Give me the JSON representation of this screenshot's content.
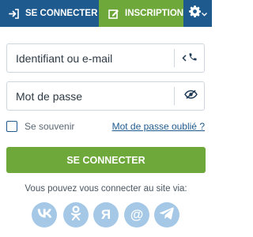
{
  "tabs": {
    "login": {
      "label": "SE CONNECTER",
      "icon": "sign-in-icon"
    },
    "signup": {
      "label": "INSCRIPTION",
      "icon": "edit-icon"
    },
    "settings": {
      "icon": "gear-icon"
    }
  },
  "form": {
    "login_field": {
      "placeholder": "Identifiant ou e-mail",
      "value": ""
    },
    "password_field": {
      "placeholder": "Mot de passe",
      "value": ""
    },
    "remember_label": "Se souvenir",
    "remember_checked": false,
    "forgot_link": "Mot de passe oublié ?",
    "submit_label": "SE CONNECTER"
  },
  "social": {
    "caption": "Vous pouvez vous connecter au site via:",
    "providers": [
      {
        "name": "VK",
        "icon": "vk-icon"
      },
      {
        "name": "Odnoklassniki",
        "icon": "odnoklassniki-icon"
      },
      {
        "name": "Yandex",
        "icon": "yandex-icon",
        "glyph": "Я"
      },
      {
        "name": "Mail.ru",
        "icon": "mail-at-icon",
        "glyph": "@"
      },
      {
        "name": "Telegram",
        "icon": "telegram-icon"
      }
    ]
  },
  "colors": {
    "primary": "#1f5a8f",
    "accent": "#6fa83a",
    "social": "#a5c8e6",
    "border": "#cfd6de"
  }
}
